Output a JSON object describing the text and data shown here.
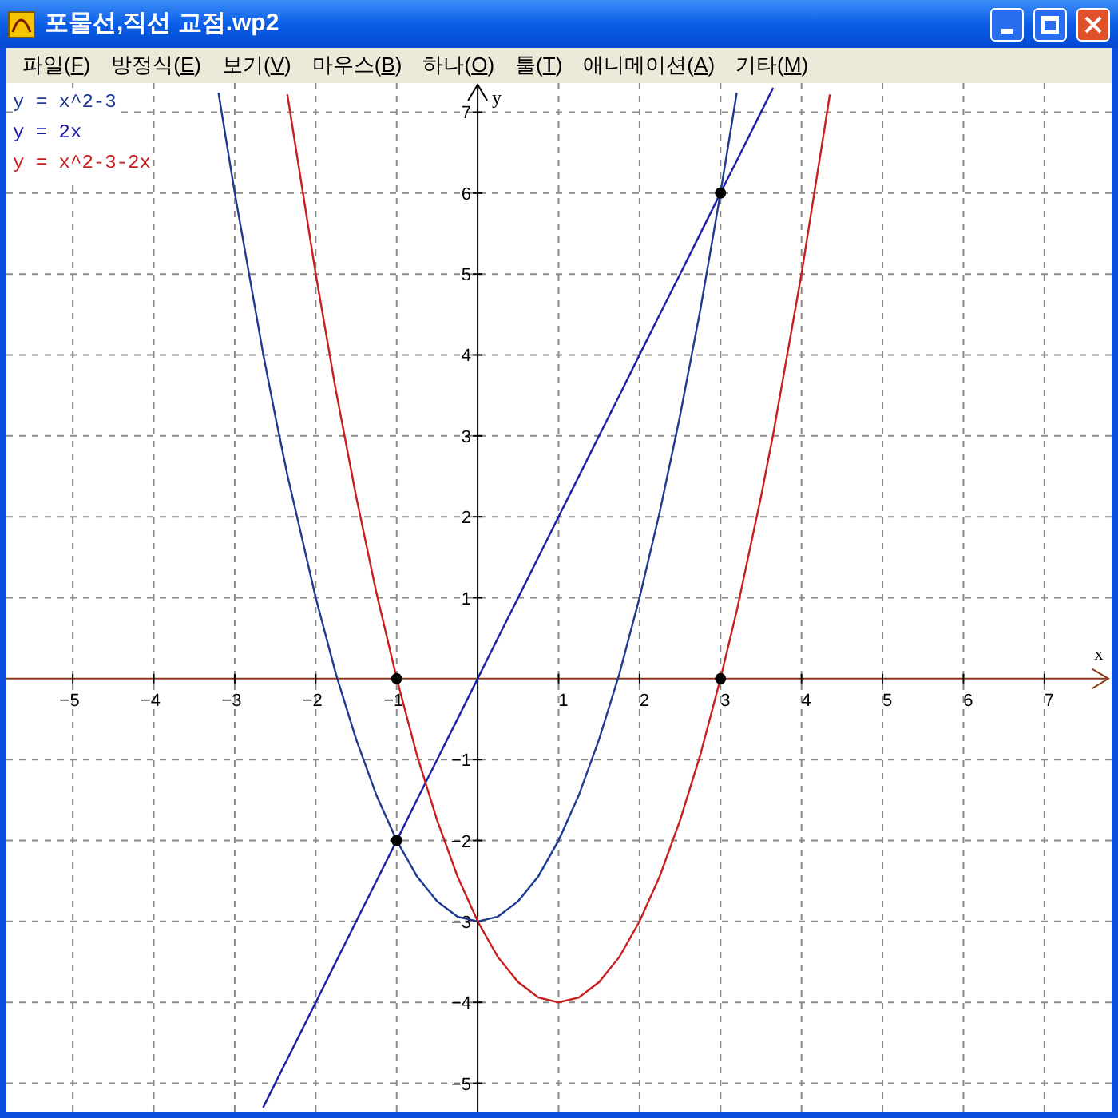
{
  "window": {
    "title": "포물선,직선 교점.wp2"
  },
  "menu": [
    "파일(F)",
    "방정식(E)",
    "보기(V)",
    "마우스(B)",
    "하나(O)",
    "툴(T)",
    "애니메이션(A)",
    "기타(M)"
  ],
  "plot": {
    "chart_data": {
      "type": "line",
      "xlabel": "x",
      "ylabel": "y",
      "xlim": [
        -5.82,
        7.83
      ],
      "ylim": [
        -5.35,
        7.36
      ],
      "grid": true,
      "xticks": [
        -5,
        -4,
        -3,
        -2,
        -1,
        1,
        2,
        3,
        4,
        5,
        6,
        7
      ],
      "yticks": [
        -5,
        -4,
        -3,
        -2,
        -1,
        1,
        2,
        3,
        4,
        5,
        6,
        7
      ],
      "x": [
        -3.2,
        -3,
        -2.65,
        -2.5,
        -2.35,
        -2,
        -1.75,
        -1.5,
        -1.25,
        -1,
        -0.75,
        -0.5,
        -0.25,
        0,
        0.25,
        0.5,
        0.75,
        1,
        1.25,
        1.5,
        1.75,
        2,
        2.25,
        2.5,
        2.75,
        3,
        3.2,
        3.5,
        3.65,
        4,
        4.35
      ],
      "series": [
        {
          "name": "y = x^2-3",
          "color": "#1f3a93",
          "values": [
            7.24,
            6,
            4.02,
            3.25,
            2.52,
            1,
            0.06,
            -0.75,
            -1.44,
            -2,
            -2.44,
            -2.75,
            -2.94,
            -3,
            -2.94,
            -2.75,
            -2.44,
            -2,
            -1.44,
            -0.75,
            0.06,
            1,
            2.06,
            3.25,
            4.56,
            6,
            7.24,
            null,
            null,
            null,
            null
          ]
        },
        {
          "name": "y = 2x",
          "color": "#1c1ca8",
          "values": [
            null,
            null,
            -5.3,
            -5,
            -4.7,
            -4,
            -3.5,
            -3,
            -2.5,
            -2,
            -1.5,
            -1,
            -0.5,
            0,
            0.5,
            1,
            1.5,
            2,
            2.5,
            3,
            3.5,
            4,
            4.5,
            5,
            5.5,
            6,
            6.4,
            7,
            7.3,
            null,
            null
          ]
        },
        {
          "name": "y = x^2-3-2x",
          "color": "#c81e1e",
          "values": [
            null,
            null,
            null,
            null,
            7.22,
            5,
            3.56,
            2.25,
            1.06,
            0,
            -0.94,
            -1.75,
            -2.44,
            -3,
            -3.44,
            -3.75,
            -3.94,
            -4,
            -3.94,
            -3.75,
            -3.44,
            -3,
            -2.44,
            -1.75,
            -0.94,
            0,
            0.84,
            2.25,
            3.02,
            5,
            7.22
          ]
        }
      ]
    }
  }
}
